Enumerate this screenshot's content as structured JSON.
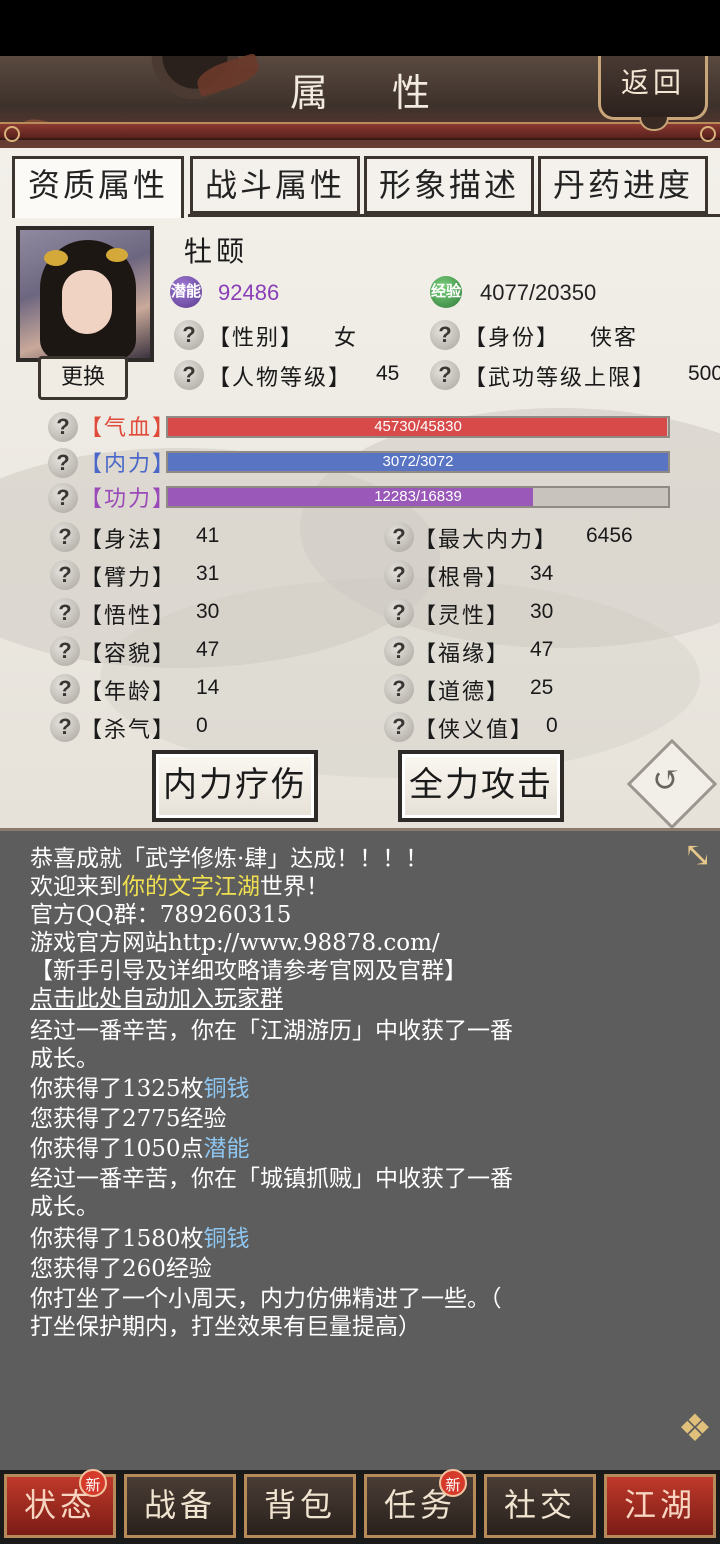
{
  "header": {
    "title": "属性",
    "back_label": "返回"
  },
  "tabs": [
    {
      "label": "资质属性",
      "active": true
    },
    {
      "label": "战斗属性",
      "active": false
    },
    {
      "label": "形象描述",
      "active": false
    },
    {
      "label": "丹药进度",
      "active": false
    }
  ],
  "profile": {
    "name": "牡颐",
    "change_label": "更换",
    "potential_icon_text": "潜能",
    "potential": "92486",
    "exp_icon_text": "经验",
    "exp": "4077/20350",
    "gender_label": "【性别】",
    "gender": "女",
    "identity_label": "【身份】",
    "identity": "侠客",
    "level_label": "【人物等级】",
    "level": "45",
    "skill_cap_label": "【武功等级上限】",
    "skill_cap": "500"
  },
  "bars": [
    {
      "label": "【气血】",
      "text": "45730/45830",
      "value": 45730,
      "max": 45830,
      "color": "#d84a4a",
      "label_color": "#e04a3a"
    },
    {
      "label": "【内力】",
      "text": "3072/3072",
      "value": 3072,
      "max": 3072,
      "color": "#5a74c4",
      "label_color": "#4a68c8"
    },
    {
      "label": "【功力】",
      "text": "12283/16839",
      "value": 12283,
      "max": 16839,
      "color": "#9a58b8",
      "label_color": "#9a4ab8"
    }
  ],
  "stats_left": [
    {
      "label": "【身法】",
      "value": "41"
    },
    {
      "label": "【臂力】",
      "value": "31"
    },
    {
      "label": "【悟性】",
      "value": "30"
    },
    {
      "label": "【容貌】",
      "value": "47"
    },
    {
      "label": "【年龄】",
      "value": "14"
    },
    {
      "label": "【杀气】",
      "value": "0"
    }
  ],
  "stats_right": [
    {
      "label": "【最大内力】",
      "value": "6456"
    },
    {
      "label": "【根骨】",
      "value": "34"
    },
    {
      "label": "【灵性】",
      "value": "30"
    },
    {
      "label": "【福缘】",
      "value": "47"
    },
    {
      "label": "【道德】",
      "value": "25"
    },
    {
      "label": "【侠义值】",
      "value": "0"
    }
  ],
  "actions": {
    "heal_label": "内力疗伤",
    "attack_label": "全力攻击"
  },
  "log": {
    "l1": "恭喜成就「武学修炼·肆」达成！！！！",
    "l2a": "欢迎来到",
    "l2b": "你的文字江湖",
    "l2c": "世界！",
    "l3": "官方QQ群：789260315",
    "l4": "游戏官方网站http://www.98878.com/",
    "l5": "【新手引导及详细攻略请参考官网及官群】",
    "l6": "点击此处自动加入玩家群",
    "l7": "经过一番辛苦，你在「江湖游历」中收获了一番",
    "l8": "成长。",
    "l9a": "你获得了1325枚",
    "l9b": "铜钱",
    "l10": "您获得了2775经验",
    "l11a": "你获得了1050点",
    "l11b": "潜能",
    "l12": "经过一番辛苦，你在「城镇抓贼」中收获了一番",
    "l13": "成长。",
    "l14a": "你获得了1580枚",
    "l14b": "铜钱",
    "l15": "您获得了260经验",
    "l16": "你打坐了一个小周天，内力仿佛精进了一些。（",
    "l17": "打坐保护期内，打坐效果有巨量提高）"
  },
  "nav": [
    {
      "label": "状态",
      "badge": "新",
      "accent": true
    },
    {
      "label": "战备",
      "badge": ""
    },
    {
      "label": "背包",
      "badge": ""
    },
    {
      "label": "任务",
      "badge": "新"
    },
    {
      "label": "社交",
      "badge": ""
    },
    {
      "label": "江湖",
      "badge": "",
      "accent": true
    }
  ],
  "colors": {
    "header_bg": "#3d312b",
    "log_bg": "#5d5d5d",
    "accent_red": "#c0392b"
  }
}
